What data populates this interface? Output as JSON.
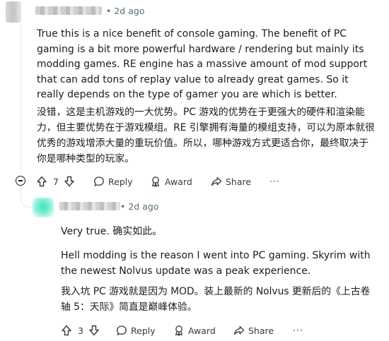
{
  "comment": {
    "timestamp": "2d ago",
    "paragraph_en": "True this is a nice benefit of console gaming. The benefit of PC gaming is a bit more powerful hardware / rendering but mainly its modding games. RE engine has a massive amount of mod support that can add tons of replay value to already great games. So it really depends on the type of gamer you are which is better.",
    "paragraph_zh": "没错，这是主机游戏的一大优势。PC 游戏的优势在于更强大的硬件和渲染能力，但主要优势在于游戏模组。RE 引擎拥有海量的模组支持，可以为原本就很优秀的游戏增添大量的重玩价值。所以，哪种游戏方式更适合你，最终取决于你是哪种类型的玩家。",
    "votes": "7",
    "reply_label": "Reply",
    "award_label": "Award",
    "share_label": "Share",
    "more_label": "···"
  },
  "reply": {
    "timestamp": "2d ago",
    "line1": "Very true.   确实如此。",
    "paragraph_en": "Hell modding is the reason I went into PC gaming. Skyrim with the newest Nolvus update was a peak experience.",
    "paragraph_zh": "我入坑 PC 游戏就是因为 MOD。装上最新的 Nolvus 更新后的《上古卷轴 5：天际》简直是巅峰体验。",
    "votes": "3",
    "reply_label": "Reply",
    "award_label": "Award",
    "share_label": "Share",
    "more_label": "···"
  },
  "meta_separator": "•"
}
